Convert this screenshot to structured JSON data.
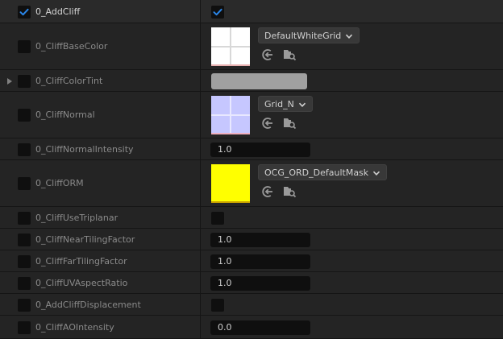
{
  "colors": {
    "panel_bg": "#242424",
    "header_bg": "#2a2a2a",
    "field_bg": "#0f0f0f",
    "check_accent": "#2a86e8",
    "tint_swatch": "#a0a0a0",
    "normal_map": "#c6c7ff",
    "orm_map": "#ffff00",
    "white_grid": "#ffffff"
  },
  "rows": [
    {
      "label": "0_AddCliff",
      "checked": true,
      "value_type": "checkbox",
      "value_checked": true
    },
    {
      "label": "0_CliffBaseColor",
      "checked": false,
      "value_type": "texture",
      "texture": "DefaultWhiteGrid",
      "icons": [
        "use-selected-asset-icon",
        "browse-asset-icon"
      ]
    },
    {
      "label": "0_CliffColorTint",
      "checked": false,
      "expandable": true,
      "value_type": "color"
    },
    {
      "label": "0_CliffNormal",
      "checked": false,
      "value_type": "texture",
      "texture": "Grid_N",
      "icons": [
        "use-selected-asset-icon",
        "browse-asset-icon"
      ]
    },
    {
      "label": "0_CliffNormalIntensity",
      "checked": false,
      "value_type": "number",
      "value": "1.0"
    },
    {
      "label": "0_CliffORM",
      "checked": false,
      "value_type": "texture",
      "texture": "OCG_ORD_DefaultMask",
      "icons": [
        "use-selected-asset-icon",
        "browse-asset-icon"
      ]
    },
    {
      "label": "0_CliffUseTriplanar",
      "checked": false,
      "value_type": "checkbox",
      "value_checked": false
    },
    {
      "label": "0_CliffNearTilingFactor",
      "checked": false,
      "value_type": "number",
      "value": "1.0"
    },
    {
      "label": "0_CliffFarTilingFactor",
      "checked": false,
      "value_type": "number",
      "value": "1.0"
    },
    {
      "label": "0_CliffUVAspectRatio",
      "checked": false,
      "value_type": "number",
      "value": "1.0"
    },
    {
      "label": "0_AddCliffDisplacement",
      "checked": false,
      "value_type": "checkbox",
      "value_checked": false
    },
    {
      "label": "0_CliffAOIntensity",
      "checked": false,
      "value_type": "number",
      "value": "0.0"
    }
  ]
}
